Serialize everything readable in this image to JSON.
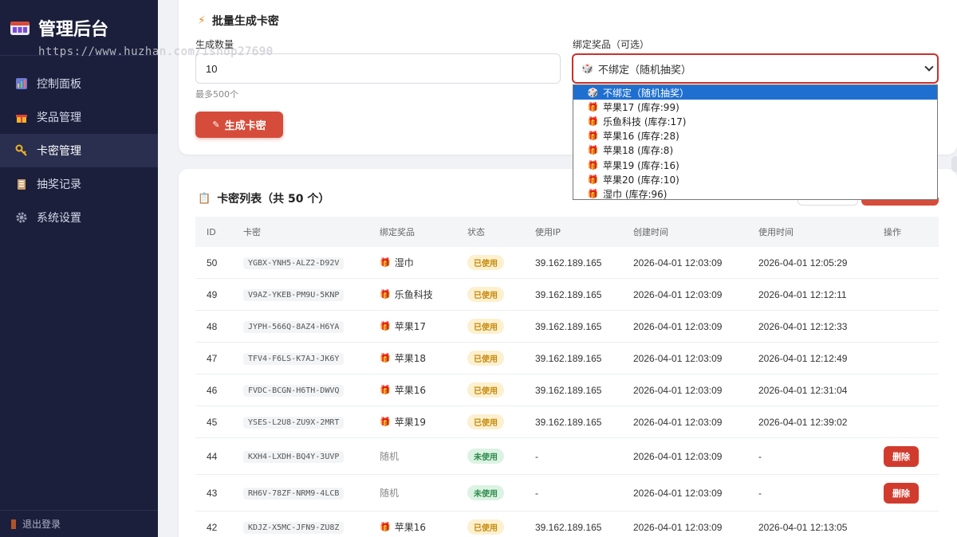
{
  "sidebar": {
    "title": "管理后台",
    "items": [
      {
        "label": "控制面板",
        "icon": "chart-icon"
      },
      {
        "label": "奖品管理",
        "icon": "gift-icon"
      },
      {
        "label": "卡密管理",
        "icon": "key-icon"
      },
      {
        "label": "抽奖记录",
        "icon": "clipboard-icon"
      },
      {
        "label": "系统设置",
        "icon": "gear-icon"
      }
    ],
    "active_index": 2,
    "logout": "退出登录"
  },
  "watermark": "https://www.huzhan.com/ishop27690",
  "generate": {
    "title": "批量生成卡密",
    "count_label": "生成数量",
    "count_value": "10",
    "count_hint": "最多500个",
    "prize_label": "绑定奖品（可选）",
    "prize_selected": "不绑定（随机抽奖）",
    "button": "生成卡密",
    "options": [
      "不绑定（随机抽奖）",
      "苹果17 (库存:99)",
      "乐鱼科技 (库存:17)",
      "苹果16 (库存:28)",
      "苹果18 (库存:8)",
      "苹果19 (库存:16)",
      "苹果20 (库存:10)",
      "湿巾 (库存:96)"
    ]
  },
  "list": {
    "title": "卡密列表（共 50 个）",
    "headers": [
      "ID",
      "卡密",
      "绑定奖品",
      "状态",
      "使用IP",
      "创建时间",
      "使用时间",
      "操作"
    ],
    "rows": [
      {
        "id": "50",
        "code": "YGBX-YNH5-ALZ2-D92V",
        "prize": "湿巾",
        "status": "已使用",
        "ip": "39.162.189.165",
        "created": "2026-04-01 12:03:09",
        "used": "2026-04-01 12:05:29",
        "op": ""
      },
      {
        "id": "49",
        "code": "V9AZ-YKEB-PM9U-5KNP",
        "prize": "乐鱼科技",
        "status": "已使用",
        "ip": "39.162.189.165",
        "created": "2026-04-01 12:03:09",
        "used": "2026-04-01 12:12:11",
        "op": ""
      },
      {
        "id": "48",
        "code": "JYPH-566Q-8AZ4-H6YA",
        "prize": "苹果17",
        "status": "已使用",
        "ip": "39.162.189.165",
        "created": "2026-04-01 12:03:09",
        "used": "2026-04-01 12:12:33",
        "op": ""
      },
      {
        "id": "47",
        "code": "TFV4-F6LS-K7AJ-JK6Y",
        "prize": "苹果18",
        "status": "已使用",
        "ip": "39.162.189.165",
        "created": "2026-04-01 12:03:09",
        "used": "2026-04-01 12:12:49",
        "op": ""
      },
      {
        "id": "46",
        "code": "FVDC-BCGN-H6TH-DWVQ",
        "prize": "苹果16",
        "status": "已使用",
        "ip": "39.162.189.165",
        "created": "2026-04-01 12:03:09",
        "used": "2026-04-01 12:31:04",
        "op": ""
      },
      {
        "id": "45",
        "code": "YSES-L2U8-ZU9X-2MRT",
        "prize": "苹果19",
        "status": "已使用",
        "ip": "39.162.189.165",
        "created": "2026-04-01 12:03:09",
        "used": "2026-04-01 12:39:02",
        "op": ""
      },
      {
        "id": "44",
        "code": "KXH4-LXDH-BQ4Y-3UVP",
        "prize": "随机",
        "status": "未使用",
        "ip": "-",
        "created": "2026-04-01 12:03:09",
        "used": "-",
        "op": "删除"
      },
      {
        "id": "43",
        "code": "RH6V-78ZF-NRM9-4LCB",
        "prize": "随机",
        "status": "未使用",
        "ip": "-",
        "created": "2026-04-01 12:03:09",
        "used": "-",
        "op": "删除"
      },
      {
        "id": "42",
        "code": "KDJZ-X5MC-JFN9-ZU8Z",
        "prize": "苹果16",
        "status": "已使用",
        "ip": "39.162.189.165",
        "created": "2026-04-01 12:03:09",
        "used": "2026-04-01 12:13:05",
        "op": ""
      }
    ]
  },
  "colors": {
    "sidebar_bg": "#1b1f3b",
    "accent": "#d64c3a",
    "select_border": "#c9302c"
  }
}
